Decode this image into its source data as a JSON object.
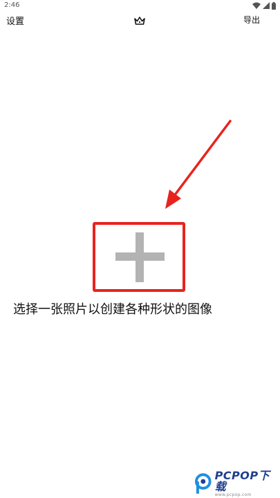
{
  "status_bar": {
    "time": "2:46",
    "icons": [
      "wifi-icon",
      "signal-icon",
      "battery-icon"
    ]
  },
  "app_bar": {
    "settings_label": "设置",
    "crown_icon": "crown-icon",
    "export_label": "导出"
  },
  "main": {
    "add_icon": "plus-icon",
    "prompt": "选择一张照片以创建各种形状的图像"
  },
  "annotation": {
    "color": "#e8231d"
  },
  "watermark": {
    "brand": "PCPOP下载",
    "subtitle": "www.pcpop.com"
  }
}
